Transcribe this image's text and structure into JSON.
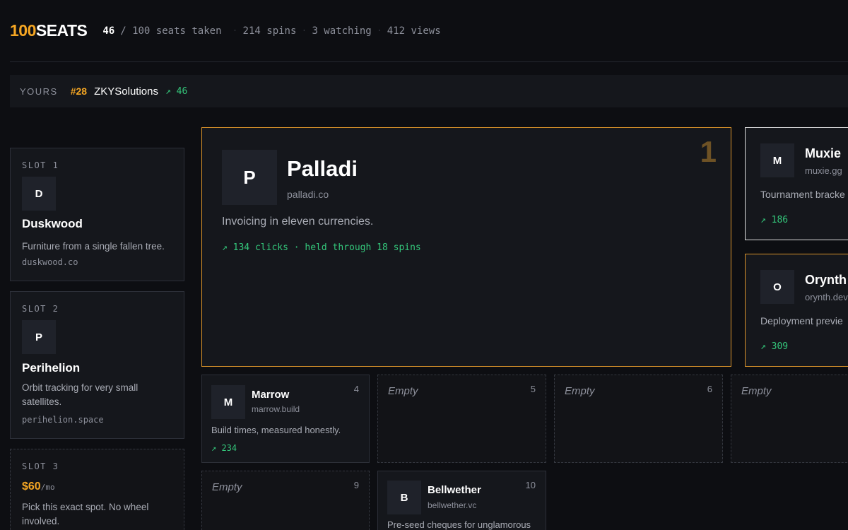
{
  "header": {
    "logo_num": "100",
    "logo_word": "SEATS",
    "seats_taken": "46",
    "seats_total": "/ 100 seats taken",
    "spins": "214 spins",
    "watching": "3 watching",
    "views": "412 views"
  },
  "yours": {
    "label": "YOURS",
    "rank": "#28",
    "name": "ZKYSolutions",
    "clicks": "↗ 46"
  },
  "sidebar": [
    {
      "slot": "SLOT 1",
      "initial": "D",
      "name": "Duskwood",
      "desc": "Furniture from a single fallen tree.",
      "domain": "duskwood.co"
    },
    {
      "slot": "SLOT 2",
      "initial": "P",
      "name": "Perihelion",
      "desc": "Orbit tracking for very small satellites.",
      "domain": "perihelion.space"
    },
    {
      "slot": "SLOT 3",
      "price": "$60",
      "price_unit": "/mo",
      "desc": "Pick this exact spot. No wheel involved."
    }
  ],
  "featured": {
    "number": "1",
    "initial": "P",
    "name": "Palladi",
    "domain": "palladi.co",
    "desc": "Invoicing in eleven currencies.",
    "stats": "↗ 134 clicks · held through 18 spins"
  },
  "right_cards": [
    {
      "initial": "M",
      "name": "Muxie",
      "domain": "muxie.gg",
      "desc": "Tournament bracke",
      "clicks": "↗ 186"
    },
    {
      "initial": "O",
      "name": "Orynth",
      "domain": "orynth.dev",
      "desc": "Deployment previe",
      "clicks": "↗ 309"
    }
  ],
  "small_cards": {
    "marrow": {
      "number": "4",
      "initial": "M",
      "name": "Marrow",
      "domain": "marrow.build",
      "desc": "Build times, measured honestly.",
      "clicks": "↗ 234"
    },
    "empty5": {
      "number": "5",
      "text": "Empty"
    },
    "empty6": {
      "number": "6",
      "text": "Empty"
    },
    "empty7": {
      "text": "Empty"
    },
    "empty9": {
      "number": "9",
      "text": "Empty"
    },
    "bellwether": {
      "number": "10",
      "initial": "B",
      "name": "Bellwether",
      "domain": "bellwether.vc",
      "desc": "Pre-seed cheques for unglamorous"
    }
  },
  "colors": {
    "accent": "#f5a623",
    "green": "#34c77b",
    "bg": "#0d0e12"
  }
}
